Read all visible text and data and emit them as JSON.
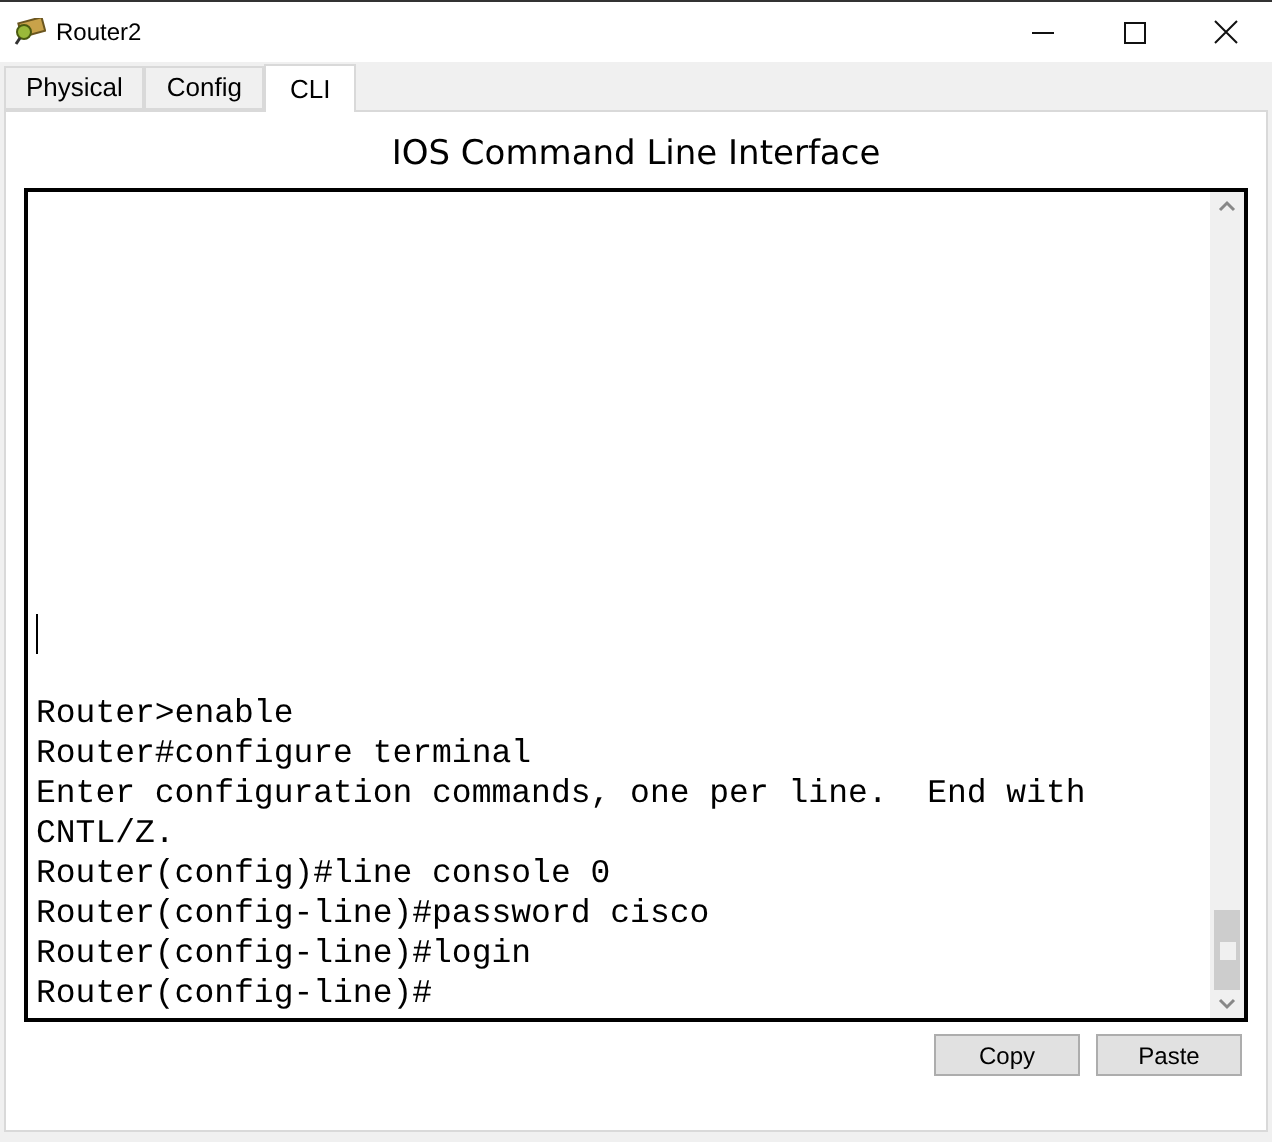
{
  "window": {
    "title": "Router2"
  },
  "tabs": [
    {
      "label": "Physical",
      "selected": false
    },
    {
      "label": "Config",
      "selected": false
    },
    {
      "label": "CLI",
      "selected": true
    }
  ],
  "panel_title": "IOS Command Line Interface",
  "terminal": {
    "lines": [
      "Router>enable",
      "Router#configure terminal",
      "Enter configuration commands, one per line.  End with",
      "CNTL/Z.",
      "Router(config)#line console 0",
      "Router(config-line)#password cisco",
      "Router(config-line)#login",
      "Router(config-line)#"
    ]
  },
  "buttons": [
    "Copy",
    "Paste"
  ]
}
